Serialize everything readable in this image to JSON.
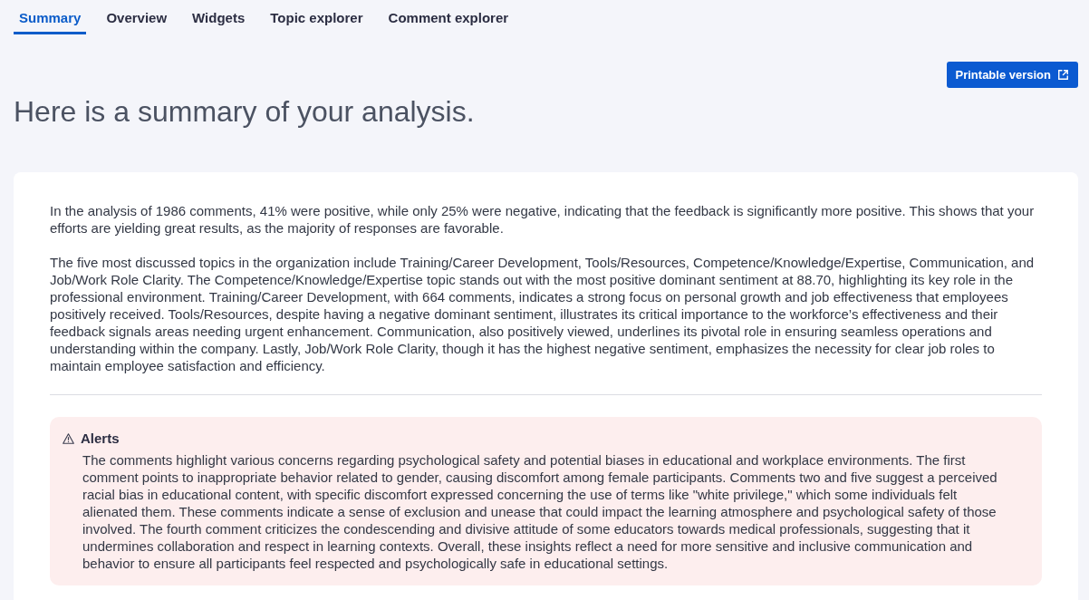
{
  "tabs": [
    {
      "label": "Summary",
      "selected": true
    },
    {
      "label": "Overview",
      "selected": false
    },
    {
      "label": "Widgets",
      "selected": false
    },
    {
      "label": "Topic explorer",
      "selected": false
    },
    {
      "label": "Comment explorer",
      "selected": false
    }
  ],
  "printable_button": {
    "label": "Printable version"
  },
  "heading": "Here is a summary of your analysis.",
  "summary": {
    "paragraphs": [
      "In the analysis of 1986 comments, 41% were positive, while only 25% were negative, indicating that the feedback is significantly more positive. This shows that your efforts are yielding great results, as the majority of responses are favorable.",
      "The five most discussed topics in the organization include Training/Career Development, Tools/Resources, Competence/Knowledge/Expertise, Communication, and Job/Work Role Clarity. The Competence/Knowledge/Expertise topic stands out with the most positive dominant sentiment at 88.70, highlighting its key role in the professional environment. Training/Career Development, with 664 comments, indicates a strong focus on personal growth and job effectiveness that employees positively received. Tools/Resources, despite having a negative dominant sentiment, illustrates its critical importance to the workforce’s effectiveness and their feedback signals areas needing urgent enhancement. Communication, also positively viewed, underlines its pivotal role in ensuring seamless operations and understanding within the company. Lastly, Job/Work Role Clarity, though it has the highest negative sentiment, emphasizes the necessity for clear job roles to maintain employee satisfaction and efficiency."
    ]
  },
  "alert": {
    "title": "Alerts",
    "body": "The comments highlight various concerns regarding psychological safety and potential biases in educational and workplace environments. The first comment points to inappropriate behavior related to gender, causing discomfort among female participants. Comments two and five suggest a perceived racial bias in educational content, with specific discomfort expressed concerning the use of terms like \"white privilege,\" which some individuals felt alienated them. These comments indicate a sense of exclusion and unease that could impact the learning atmosphere and psychological safety of those involved. The fourth comment criticizes the condescending and divisive attitude of some educators towards medical professionals, suggesting that it undermines collaboration and respect in learning contexts. Overall, these insights reflect a need for more sensitive and inclusive communication and behavior to ensure all participants feel respected and psychologically safe in educational settings."
  }
}
